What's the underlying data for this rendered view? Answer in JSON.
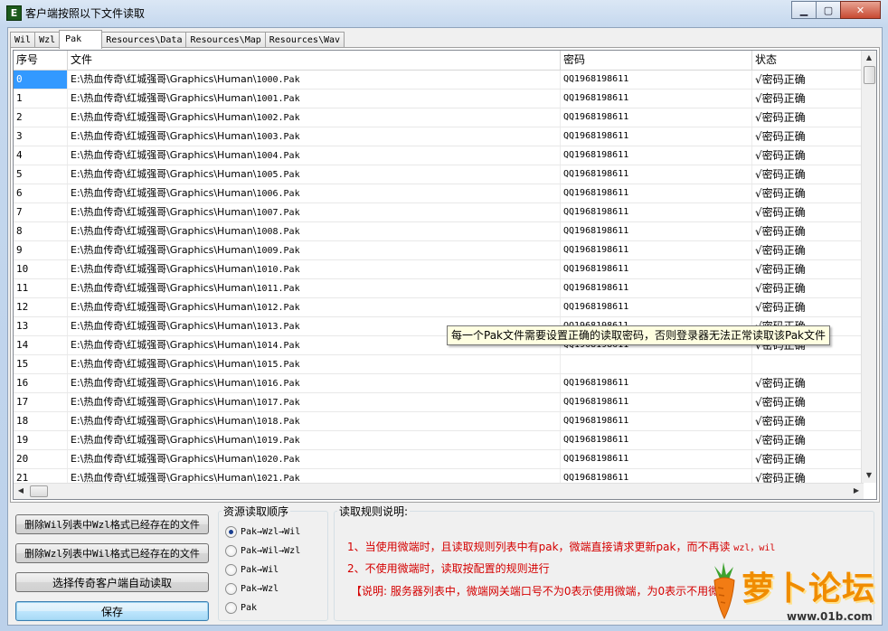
{
  "window": {
    "title": "客户端按照以下文件读取",
    "icon_letter": "E",
    "minimize_glyph": "▁",
    "maximize_glyph": "▢",
    "close_glyph": "✕"
  },
  "tabs": [
    {
      "label": "Wil",
      "active": false
    },
    {
      "label": "Wzl",
      "active": false
    },
    {
      "label": "Pak",
      "active": true
    },
    {
      "label": "Resources\\Data",
      "active": false
    },
    {
      "label": "Resources\\Map",
      "active": false
    },
    {
      "label": "Resources\\Wav",
      "active": false
    }
  ],
  "table": {
    "columns": [
      "序号",
      "文件",
      "密码",
      "状态"
    ],
    "path_prefix": "E:\\热血传奇\\红城强哥\\Graphics\\Human\\",
    "rows": [
      {
        "idx": "0",
        "file_name": "1000.Pak",
        "password": "QQ1968198611",
        "status": "√密码正确"
      },
      {
        "idx": "1",
        "file_name": "1001.Pak",
        "password": "QQ1968198611",
        "status": "√密码正确"
      },
      {
        "idx": "2",
        "file_name": "1002.Pak",
        "password": "QQ1968198611",
        "status": "√密码正确"
      },
      {
        "idx": "3",
        "file_name": "1003.Pak",
        "password": "QQ1968198611",
        "status": "√密码正确"
      },
      {
        "idx": "4",
        "file_name": "1004.Pak",
        "password": "QQ1968198611",
        "status": "√密码正确"
      },
      {
        "idx": "5",
        "file_name": "1005.Pak",
        "password": "QQ1968198611",
        "status": "√密码正确"
      },
      {
        "idx": "6",
        "file_name": "1006.Pak",
        "password": "QQ1968198611",
        "status": "√密码正确"
      },
      {
        "idx": "7",
        "file_name": "1007.Pak",
        "password": "QQ1968198611",
        "status": "√密码正确"
      },
      {
        "idx": "8",
        "file_name": "1008.Pak",
        "password": "QQ1968198611",
        "status": "√密码正确"
      },
      {
        "idx": "9",
        "file_name": "1009.Pak",
        "password": "QQ1968198611",
        "status": "√密码正确"
      },
      {
        "idx": "10",
        "file_name": "1010.Pak",
        "password": "QQ1968198611",
        "status": "√密码正确"
      },
      {
        "idx": "11",
        "file_name": "1011.Pak",
        "password": "QQ1968198611",
        "status": "√密码正确"
      },
      {
        "idx": "12",
        "file_name": "1012.Pak",
        "password": "QQ1968198611",
        "status": "√密码正确"
      },
      {
        "idx": "13",
        "file_name": "1013.Pak",
        "password": "QQ1968198611",
        "status": "√密码正确"
      },
      {
        "idx": "14",
        "file_name": "1014.Pak",
        "password": "QQ1968198611",
        "status": "√密码正确"
      },
      {
        "idx": "15",
        "file_name": "1015.Pak",
        "password": "",
        "status": ""
      },
      {
        "idx": "16",
        "file_name": "1016.Pak",
        "password": "QQ1968198611",
        "status": "√密码正确"
      },
      {
        "idx": "17",
        "file_name": "1017.Pak",
        "password": "QQ1968198611",
        "status": "√密码正确"
      },
      {
        "idx": "18",
        "file_name": "1018.Pak",
        "password": "QQ1968198611",
        "status": "√密码正确"
      },
      {
        "idx": "19",
        "file_name": "1019.Pak",
        "password": "QQ1968198611",
        "status": "√密码正确"
      },
      {
        "idx": "20",
        "file_name": "1020.Pak",
        "password": "QQ1968198611",
        "status": "√密码正确"
      },
      {
        "idx": "21",
        "file_name": "1021.Pak",
        "password": "QQ1968198611",
        "status": "√密码正确"
      }
    ],
    "selected_row": "0"
  },
  "tooltip": "每一个Pak文件需要设置正确的读取密码，否则登录器无法正常读取该Pak文件",
  "buttons": {
    "delete_wil": "删除Wil列表中Wzl格式已经存在的文件",
    "delete_wzl": "删除Wzl列表中Wil格式已经存在的文件",
    "auto_read": "选择传奇客户端自动读取",
    "save": "保存"
  },
  "resource_order": {
    "title": "资源读取顺序",
    "options": [
      {
        "label": "Pak→Wzl→Wil",
        "selected": true
      },
      {
        "label": "Pak→Wil→Wzl",
        "selected": false
      },
      {
        "label": "Pak→Wil",
        "selected": false
      },
      {
        "label": "Pak→Wzl",
        "selected": false
      },
      {
        "label": "Pak",
        "selected": false
      }
    ]
  },
  "rules": {
    "title": "读取规则说明:",
    "line1_a": "1、当使用微端时，且读取规则列表中有pak，微端直接请求更新pak，而不再读 ",
    "line1_b": "wzl，wil",
    "line2": "2、不使用微端时，读取按配置的规则进行",
    "line3": "【说明: 服务器列表中，微端网关端口号不为0表示使用微端，为0表示不用微端"
  },
  "watermark": {
    "text": "萝卜论坛",
    "url": "www.01b.com"
  },
  "colors": {
    "selection": "#3399ff",
    "rule_text": "#d40000",
    "tooltip_bg": "#ffffe1"
  }
}
